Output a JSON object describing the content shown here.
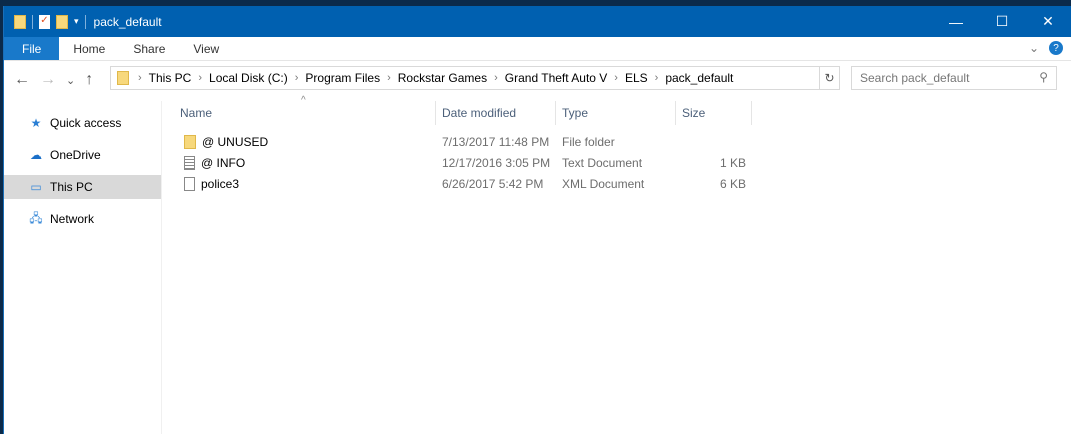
{
  "window": {
    "title": "pack_default",
    "minimize": "—",
    "maximize": "☐",
    "close": "✕"
  },
  "ribbon": {
    "tabs": [
      "File",
      "Home",
      "Share",
      "View"
    ]
  },
  "nav": {
    "back": "←",
    "forward": "→",
    "recent": "⌄",
    "up": "↑"
  },
  "address": {
    "crumbs": [
      "This PC",
      "Local Disk (C:)",
      "Program Files",
      "Rockstar Games",
      "Grand Theft Auto V",
      "ELS",
      "pack_default"
    ],
    "refresh": "↻"
  },
  "search": {
    "placeholder": "Search pack_default"
  },
  "sidebar": {
    "items": [
      "Quick access",
      "OneDrive",
      "This PC",
      "Network"
    ]
  },
  "columns": {
    "name": "Name",
    "date": "Date modified",
    "type": "Type",
    "size": "Size"
  },
  "files": [
    {
      "name": "@ UNUSED",
      "icon": "folder",
      "date": "7/13/2017 11:48 PM",
      "type": "File folder",
      "size": ""
    },
    {
      "name": "@ INFO",
      "icon": "text",
      "date": "12/17/2016 3:05 PM",
      "type": "Text Document",
      "size": "1 KB"
    },
    {
      "name": "police3",
      "icon": "xml",
      "date": "6/26/2017 5:42 PM",
      "type": "XML Document",
      "size": "6 KB"
    }
  ]
}
